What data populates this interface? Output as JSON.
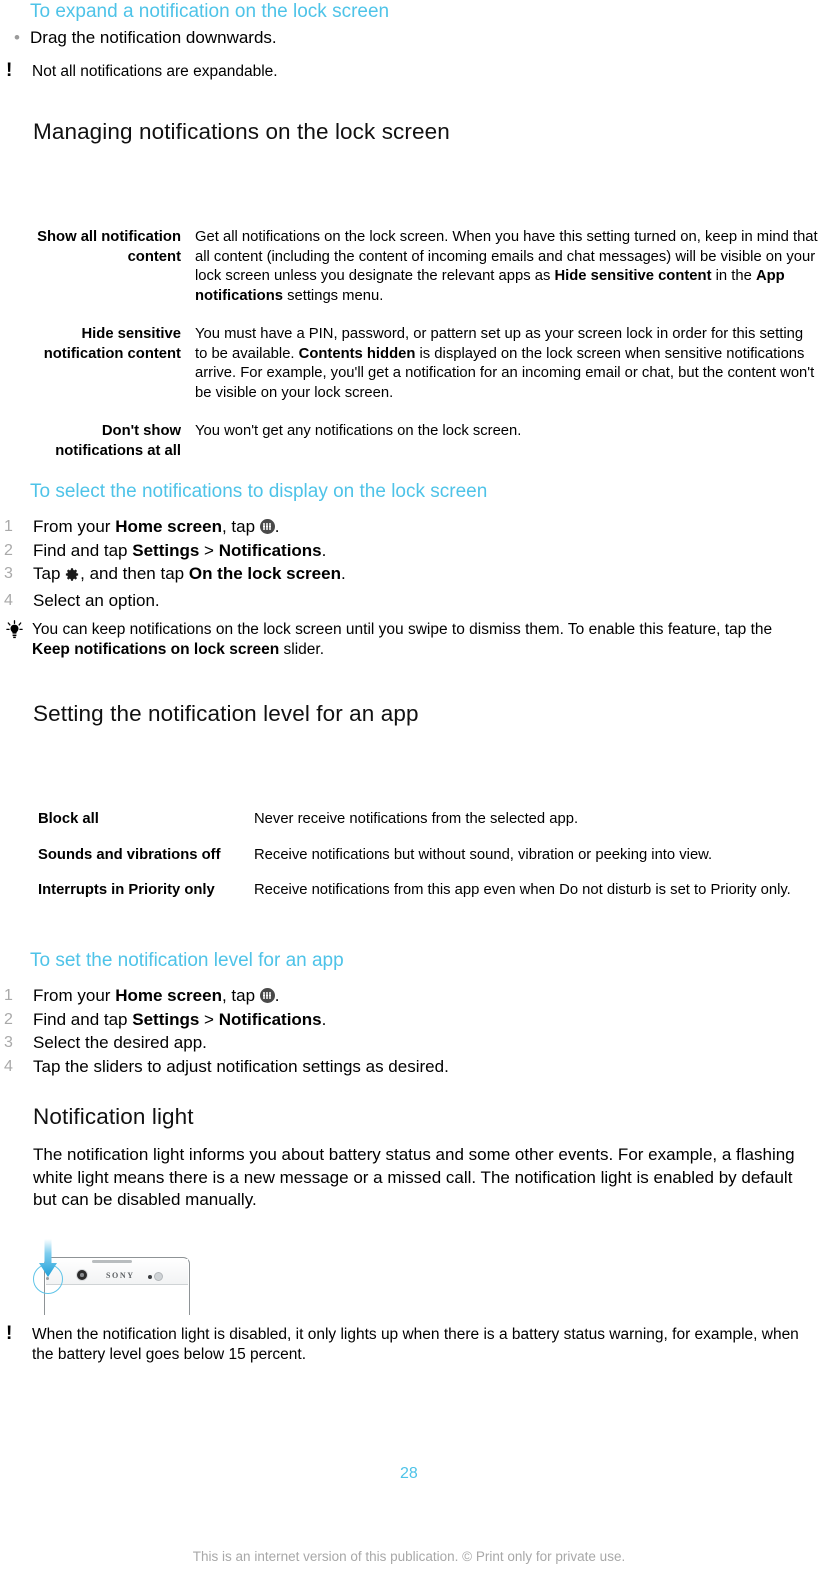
{
  "colors": {
    "accent_blue": "#4ec3e8",
    "body_text": "#000000",
    "muted_gray": "#a8a8a8",
    "bullet_gray": "#9b9b9b",
    "number_gray": "#a9a9a9"
  },
  "sections": {
    "expand_notification": {
      "heading": "To expand a notification on the lock screen",
      "bullet": "Drag the notification downwards.",
      "note": "Not all notifications are expandable.",
      "note_icon": "exclamation-icon",
      "bullet_icon": "bullet-dot-icon"
    },
    "managing_notifications": {
      "heading": "Managing notifications on the lock screen",
      "table": {
        "rows": [
          {
            "label": "Show all notification content",
            "description_parts": [
              {
                "text": "Get all notifications on the lock screen. When you have this setting turned on, keep in mind that all content (including the content of incoming emails and chat messages) will be visible on your lock screen unless you designate the relevant apps as ",
                "bold": false
              },
              {
                "text": "Hide sensitive content",
                "bold": true
              },
              {
                "text": " in the ",
                "bold": false
              },
              {
                "text": "App notifications",
                "bold": true
              },
              {
                "text": " settings menu.",
                "bold": false
              }
            ]
          },
          {
            "label": "Hide sensitive notification content",
            "description_parts": [
              {
                "text": "You must have a PIN, password, or pattern set up as your screen lock in order for this setting to be available. ",
                "bold": false
              },
              {
                "text": "Contents hidden",
                "bold": true
              },
              {
                "text": " is displayed on the lock screen when sensitive notifications arrive. For example, you'll get a notification for an incoming email or chat, but the content won't be visible on your lock screen.",
                "bold": false
              }
            ]
          },
          {
            "label": "Don't show notifications at all",
            "description_parts": [
              {
                "text": "You won't get any notifications on the lock screen.",
                "bold": false
              }
            ]
          }
        ]
      }
    },
    "select_notifications": {
      "heading": "To select the notifications to display on the lock screen",
      "steps": [
        {
          "number": "1",
          "parts": [
            {
              "text": "From your ",
              "bold": false
            },
            {
              "text": "Home screen",
              "bold": true
            },
            {
              "text": ", tap ",
              "bold": false
            },
            {
              "icon": "app-drawer-icon"
            },
            {
              "text": ".",
              "bold": false
            }
          ]
        },
        {
          "number": "2",
          "parts": [
            {
              "text": "Find and tap ",
              "bold": false
            },
            {
              "text": "Settings",
              "bold": true
            },
            {
              "text": " > ",
              "bold": false
            },
            {
              "text": "Notifications",
              "bold": true
            },
            {
              "text": ".",
              "bold": false
            }
          ]
        },
        {
          "number": "3",
          "parts": [
            {
              "text": "Tap ",
              "bold": false
            },
            {
              "icon": "gear-icon"
            },
            {
              "text": ", and then tap ",
              "bold": false
            },
            {
              "text": "On the lock screen",
              "bold": true
            },
            {
              "text": ".",
              "bold": false
            }
          ]
        },
        {
          "number": "4",
          "parts": [
            {
              "text": "Select an option.",
              "bold": false
            }
          ]
        }
      ],
      "tip": {
        "icon": "lightbulb-icon",
        "parts": [
          {
            "text": "You can keep notifications on the lock screen until you swipe to dismiss them. To enable this feature, tap the ",
            "bold": false
          },
          {
            "text": "Keep notifications on lock screen",
            "bold": true
          },
          {
            "text": " slider.",
            "bold": false
          }
        ]
      }
    },
    "setting_level": {
      "heading": "Setting the notification level for an app",
      "table": {
        "rows": [
          {
            "label": "Block all",
            "description": "Never receive notifications from the selected app."
          },
          {
            "label": "Sounds and vibrations off",
            "description": "Receive notifications but without sound, vibration or peeking into view."
          },
          {
            "label": "Interrupts in Priority only",
            "description": "Receive notifications from this app even when Do not disturb is set to Priority only."
          }
        ]
      }
    },
    "set_level_steps": {
      "heading": "To set the notification level for an app",
      "steps": [
        {
          "number": "1",
          "parts": [
            {
              "text": "From your ",
              "bold": false
            },
            {
              "text": "Home screen",
              "bold": true
            },
            {
              "text": ", tap ",
              "bold": false
            },
            {
              "icon": "app-drawer-icon"
            },
            {
              "text": ".",
              "bold": false
            }
          ]
        },
        {
          "number": "2",
          "parts": [
            {
              "text": "Find and tap ",
              "bold": false
            },
            {
              "text": "Settings",
              "bold": true
            },
            {
              "text": " > ",
              "bold": false
            },
            {
              "text": "Notifications",
              "bold": true
            },
            {
              "text": ".",
              "bold": false
            }
          ]
        },
        {
          "number": "3",
          "parts": [
            {
              "text": "Select the desired app.",
              "bold": false
            }
          ]
        },
        {
          "number": "4",
          "parts": [
            {
              "text": "Tap the sliders to adjust notification settings as desired.",
              "bold": false
            }
          ]
        }
      ]
    },
    "notification_light": {
      "heading": "Notification light",
      "paragraph": "The notification light informs you about battery status and some other events. For example, a flashing white light means there is a new message or a missed call. The notification light is enabled by default but can be disabled manually.",
      "figure": {
        "name": "xperia-phone-top-illustration",
        "brand_text": "SONY",
        "callout": "notification-light-highlight"
      },
      "note": {
        "icon": "exclamation-icon",
        "text": "When the notification light is disabled, it only lights up when there is a battery status warning, for example, when the battery level goes below 15 percent."
      }
    }
  },
  "footer": {
    "page_number": "28",
    "disclaimer": "This is an internet version of this publication. © Print only for private use."
  }
}
